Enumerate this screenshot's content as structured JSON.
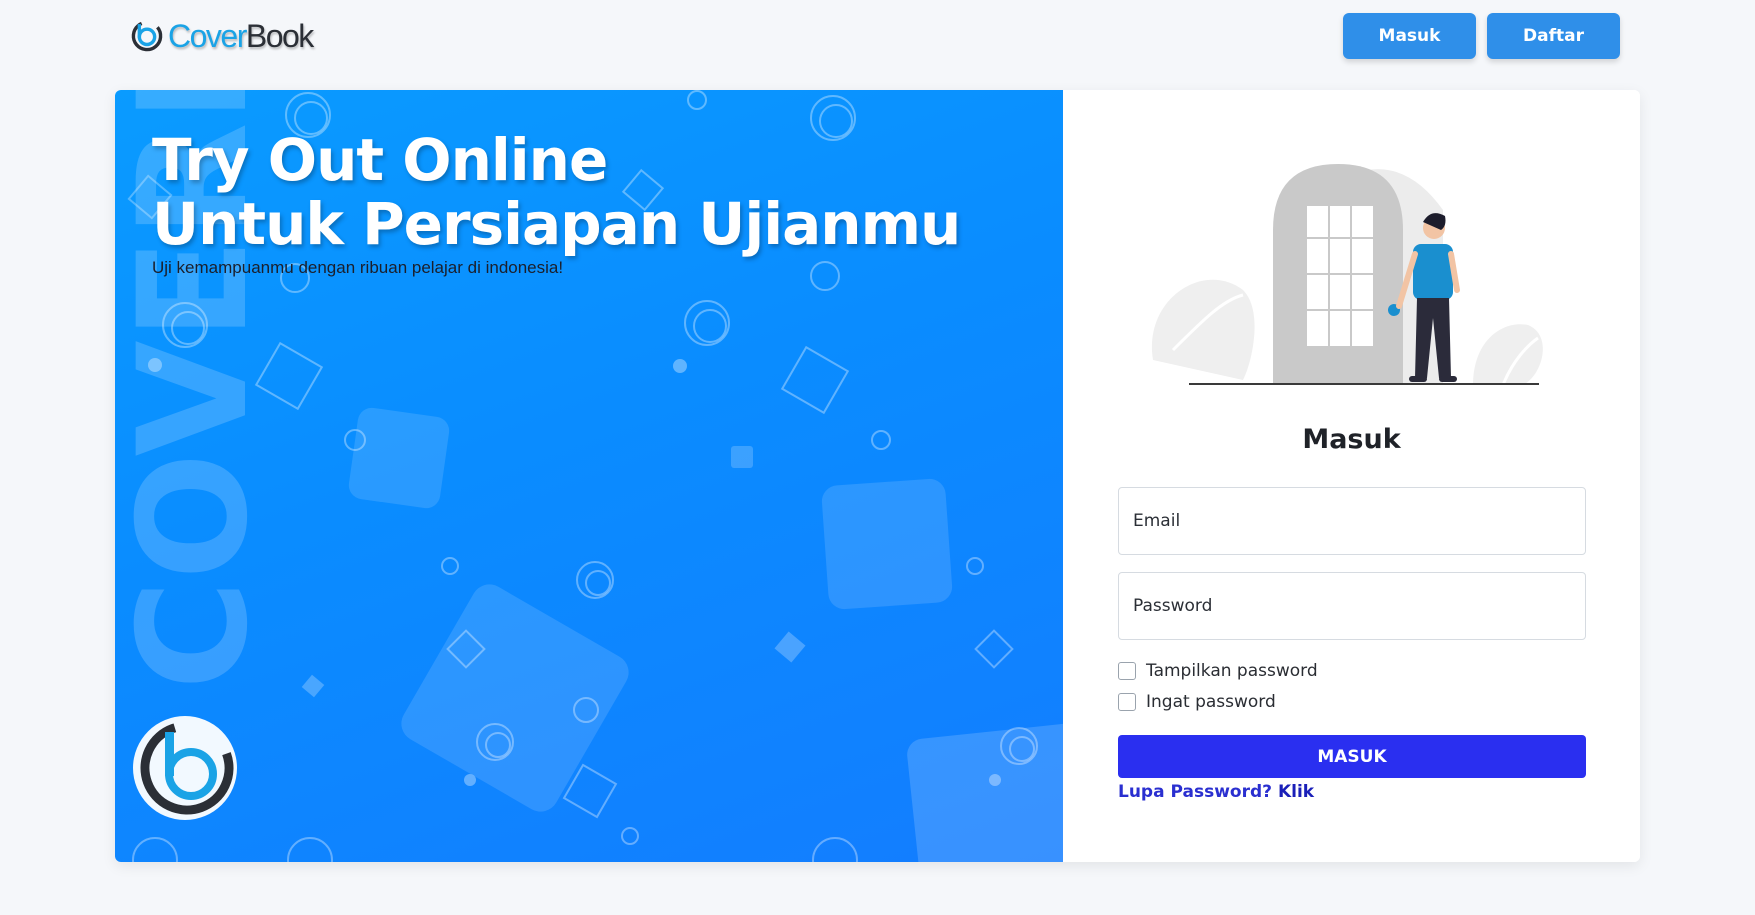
{
  "header": {
    "logo_part1": "Cover",
    "logo_part2": "Book",
    "login_button": "Masuk",
    "register_button": "Daftar"
  },
  "hero": {
    "title_line1": "Try Out Online",
    "title_line2": "Untuk Persiapan Ujianmu",
    "subtitle": "Uji kemampuanmu dengan ribuan pelajar di indonesia!",
    "watermark": "COVERB"
  },
  "login": {
    "title": "Masuk",
    "email_placeholder": "Email",
    "password_placeholder": "Password",
    "show_password_label": "Tampilkan password",
    "remember_label": "Ingat password",
    "submit_label": "MASUK",
    "forgot_text": "Lupa Password?",
    "forgot_link": "Klik"
  },
  "colors": {
    "brand_blue": "#2f8fe9",
    "submit_blue": "#2a2ff0",
    "hero_blue": "#0a9bff",
    "logo_cyan": "#1aa3e6"
  },
  "icons": [
    "coverbook-logo-icon",
    "coverbook-badge-icon",
    "door-illustration"
  ]
}
